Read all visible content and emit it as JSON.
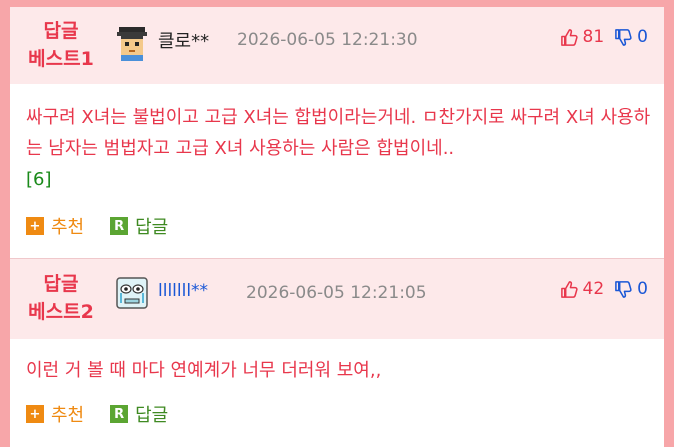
{
  "replies": [
    {
      "best_line1": "답글",
      "best_line2": "베스트1",
      "avatar": "graduate-avatar-icon",
      "nickname": "클로**",
      "date": "2026-06-05 12:21:30",
      "up_count": "81",
      "down_count": "0",
      "body": "싸구려 X녀는 불법이고 고급 X녀는 합법이라는거네. ㅁ찬가지로 싸구려 X녀 사용하는 남자는 범법자고 고급 X녀 사용하는 사람은 합법이네..",
      "sub_count": "[6]",
      "recommend_label": "추천",
      "reply_label": "답글"
    },
    {
      "best_line1": "답글",
      "best_line2": "베스트2",
      "avatar": "crying-face-avatar-icon",
      "nickname": "lllllll**",
      "date": "2026-06-05 12:21:05",
      "up_count": "42",
      "down_count": "0",
      "body": "이런 거 볼 때 마다 연예계가 너무 더러워 보여,,",
      "recommend_label": "추천",
      "reply_label": "답글"
    }
  ],
  "icons": {
    "thumbs_up": "thumbs-up-icon",
    "thumbs_down": "thumbs-down-icon",
    "recommend_badge": "+",
    "reply_badge": "R"
  },
  "colors": {
    "frame": "#f7a6a9",
    "header_bg": "#fde9ea",
    "accent_red": "#e8374c",
    "accent_blue": "#1a57d6",
    "recommend_orange": "#ef8a12",
    "reply_green": "#5ba532"
  }
}
